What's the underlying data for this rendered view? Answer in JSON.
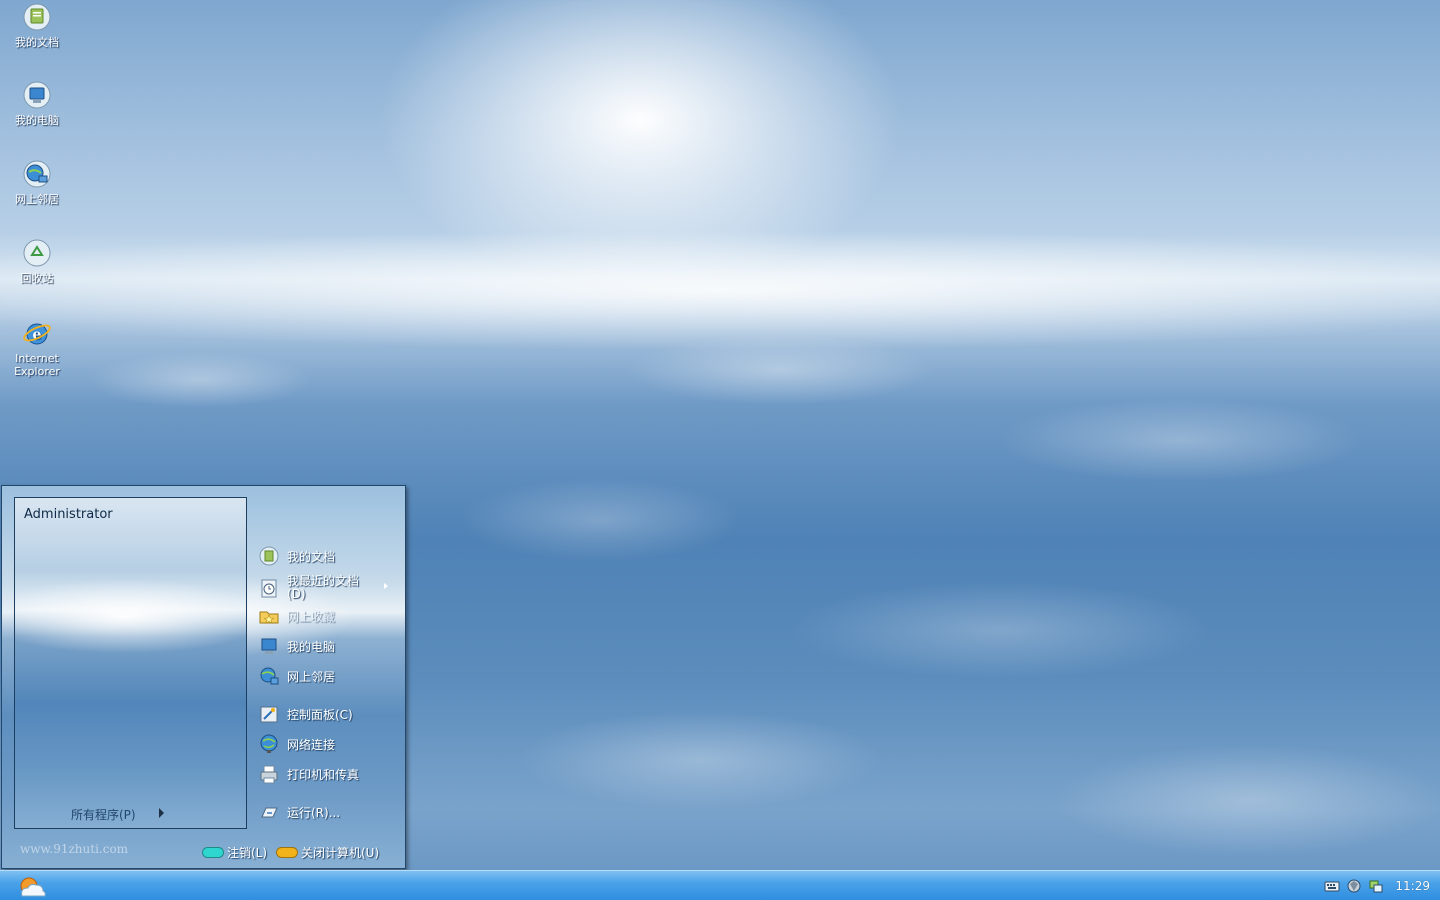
{
  "desktop": {
    "icons": [
      {
        "label": "我的文档",
        "icon": "my-documents-icon"
      },
      {
        "label": "我的电脑",
        "icon": "my-computer-icon"
      },
      {
        "label": "网上邻居",
        "icon": "network-places-icon"
      },
      {
        "label": "回收站",
        "icon": "recycle-bin-icon"
      },
      {
        "label": "Internet Explorer",
        "icon": "internet-explorer-icon"
      }
    ]
  },
  "start_menu": {
    "user": "Administrator",
    "all_programs": "所有程序(P)",
    "watermark": "www.91zhuti.com",
    "right_items": [
      {
        "label": "我的文档",
        "icon": "my-documents-icon"
      },
      {
        "label": "我最近的文档",
        "label2": "(D)",
        "icon": "recent-documents-icon"
      },
      {
        "label": "网上收藏",
        "icon": "favorites-folder-icon"
      },
      {
        "label": "我的电脑",
        "icon": "my-computer-icon"
      },
      {
        "label": "网上邻居",
        "icon": "network-places-icon"
      },
      {
        "label": "控制面板(C)",
        "icon": "control-panel-icon"
      },
      {
        "label": "网络连接",
        "icon": "network-connections-icon"
      },
      {
        "label": "打印机和传真",
        "icon": "printers-icon"
      },
      {
        "label": "运行(R)...",
        "icon": "run-icon"
      }
    ],
    "logoff": "注销(L)",
    "shutdown": "关闭计算机(U)",
    "colors": {
      "logoff_pill": "#2fd6d0",
      "shutdown_pill": "#f2b21a"
    }
  },
  "taskbar": {
    "clock": "11:29",
    "tray_icons": [
      "keyboard-icon",
      "security-shield-icon",
      "network-status-icon"
    ]
  }
}
